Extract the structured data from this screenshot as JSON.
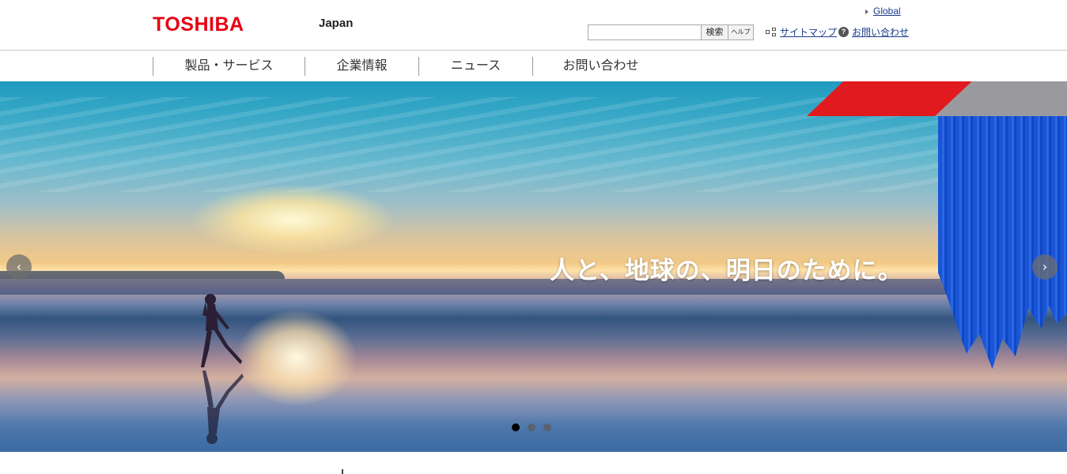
{
  "header": {
    "logo": "TOSHIBA",
    "region": "Japan",
    "global_link": "Global",
    "search": {
      "placeholder": "",
      "value": "",
      "button": "検索",
      "help": "ヘルプ"
    },
    "sitemap_link": "サイトマップ",
    "contact_link": "お問い合わせ"
  },
  "nav": {
    "items": [
      {
        "label": "製品・サービス"
      },
      {
        "label": "企業情報"
      },
      {
        "label": "ニュース"
      },
      {
        "label": "お問い合わせ"
      }
    ]
  },
  "hero": {
    "tagline": "人と、地球の、明日のために。",
    "prev_label": "‹",
    "next_label": "›",
    "slides_total": 3,
    "active_slide": 1
  },
  "colors": {
    "brand_red": "#e60012",
    "accent_blue": "#1a55d6",
    "accent_gray": "#9a9a9e",
    "link": "#1a3c8c"
  }
}
